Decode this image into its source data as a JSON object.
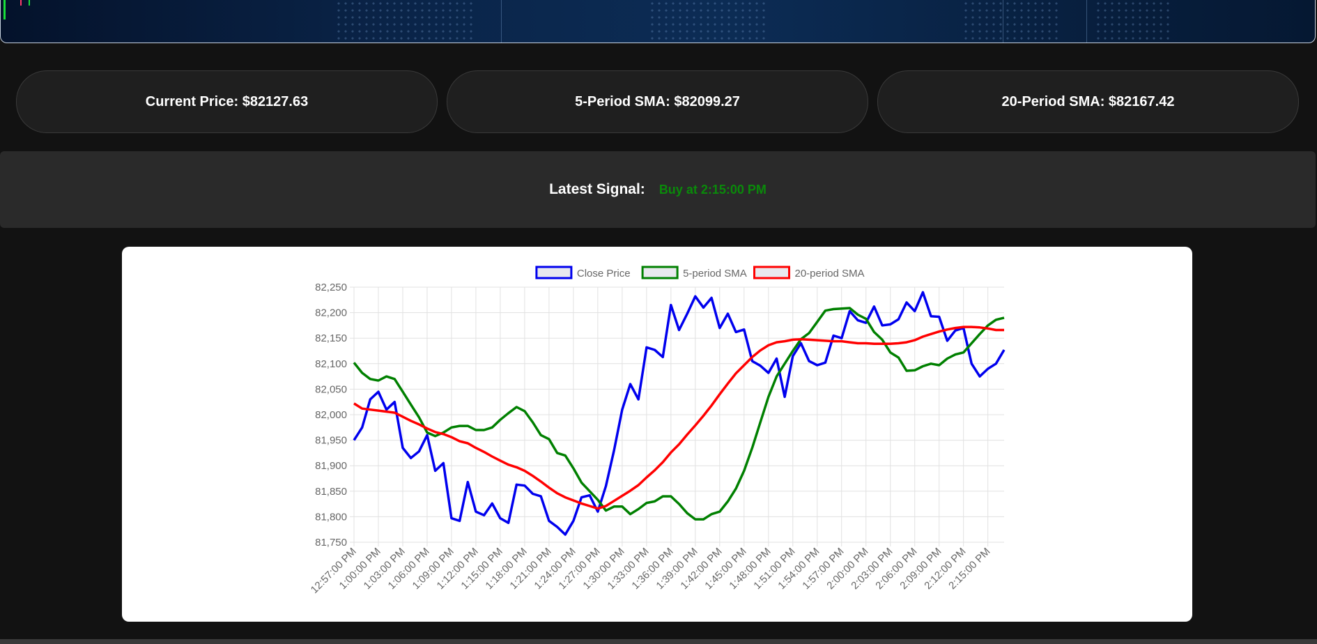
{
  "stats": {
    "current_price": "Current Price: $82127.63",
    "sma5": "5-Period SMA: $82099.27",
    "sma20": "20-Period SMA: $82167.42"
  },
  "signal": {
    "label": "Latest Signal:",
    "value": "Buy at 2:15:00 PM",
    "color": "#0a8a0a"
  },
  "chart_data": {
    "type": "line",
    "x": [
      "12:57:00 PM",
      "12:58:00 PM",
      "12:59:00 PM",
      "1:00:00 PM",
      "1:01:00 PM",
      "1:02:00 PM",
      "1:03:00 PM",
      "1:04:00 PM",
      "1:05:00 PM",
      "1:06:00 PM",
      "1:07:00 PM",
      "1:08:00 PM",
      "1:09:00 PM",
      "1:10:00 PM",
      "1:11:00 PM",
      "1:12:00 PM",
      "1:13:00 PM",
      "1:14:00 PM",
      "1:15:00 PM",
      "1:16:00 PM",
      "1:17:00 PM",
      "1:18:00 PM",
      "1:19:00 PM",
      "1:20:00 PM",
      "1:21:00 PM",
      "1:22:00 PM",
      "1:23:00 PM",
      "1:24:00 PM",
      "1:25:00 PM",
      "1:26:00 PM",
      "1:27:00 PM",
      "1:28:00 PM",
      "1:29:00 PM",
      "1:30:00 PM",
      "1:31:00 PM",
      "1:32:00 PM",
      "1:33:00 PM",
      "1:34:00 PM",
      "1:35:00 PM",
      "1:36:00 PM",
      "1:37:00 PM",
      "1:38:00 PM",
      "1:39:00 PM",
      "1:40:00 PM",
      "1:41:00 PM",
      "1:42:00 PM",
      "1:43:00 PM",
      "1:44:00 PM",
      "1:45:00 PM",
      "1:46:00 PM",
      "1:47:00 PM",
      "1:48:00 PM",
      "1:49:00 PM",
      "1:50:00 PM",
      "1:51:00 PM",
      "1:52:00 PM",
      "1:53:00 PM",
      "1:54:00 PM",
      "1:55:00 PM",
      "1:56:00 PM",
      "1:57:00 PM",
      "1:58:00 PM",
      "1:59:00 PM",
      "2:00:00 PM",
      "2:01:00 PM",
      "2:02:00 PM",
      "2:03:00 PM",
      "2:04:00 PM",
      "2:05:00 PM",
      "2:06:00 PM",
      "2:07:00 PM",
      "2:08:00 PM",
      "2:09:00 PM",
      "2:10:00 PM",
      "2:11:00 PM",
      "2:12:00 PM",
      "2:13:00 PM",
      "2:14:00 PM",
      "2:15:00 PM",
      "2:16:00 PM",
      "2:17:00 PM"
    ],
    "x_tick_labels": [
      "12:57:00 PM",
      "1:00:00 PM",
      "1:03:00 PM",
      "1:06:00 PM",
      "1:09:00 PM",
      "1:12:00 PM",
      "1:15:00 PM",
      "1:18:00 PM",
      "1:21:00 PM",
      "1:24:00 PM",
      "1:27:00 PM",
      "1:30:00 PM",
      "1:33:00 PM",
      "1:36:00 PM",
      "1:39:00 PM",
      "1:42:00 PM",
      "1:45:00 PM",
      "1:48:00 PM",
      "1:51:00 PM",
      "1:54:00 PM",
      "1:57:00 PM",
      "2:00:00 PM",
      "2:03:00 PM",
      "2:06:00 PM",
      "2:09:00 PM",
      "2:12:00 PM",
      "2:15:00 PM"
    ],
    "y_ticks": [
      "82,250",
      "82,200",
      "82,150",
      "82,100",
      "82,050",
      "82,000",
      "81,950",
      "81,900",
      "81,850",
      "81,800",
      "81,750"
    ],
    "ylim": [
      81750,
      82250
    ],
    "grid": true,
    "legend_position": "top",
    "series": [
      {
        "name": "Close Price",
        "color": "#0000ee",
        "values": [
          81950,
          81975,
          82030,
          82045,
          82010,
          82025,
          81935,
          81915,
          81928,
          81960,
          81890,
          81905,
          81797,
          81792,
          81868,
          81810,
          81803,
          81826,
          81797,
          81788,
          81863,
          81861,
          81845,
          81840,
          81792,
          81780,
          81765,
          81792,
          81838,
          81842,
          81810,
          81860,
          81930,
          82010,
          82060,
          82030,
          82132,
          82127,
          82113,
          82215,
          82166,
          82198,
          82232,
          82210,
          82229,
          82170,
          82198,
          82162,
          82167,
          82105,
          82096,
          82082,
          82110,
          82035,
          82115,
          82140,
          82105,
          82097,
          82102,
          82155,
          82150,
          82203,
          82185,
          82180,
          82212,
          82175,
          82177,
          82187,
          82220,
          82203,
          82240,
          82193,
          82192,
          82145,
          82165,
          82170,
          82100,
          82075,
          82090,
          82100,
          82127
        ]
      },
      {
        "name": "5-period SMA",
        "color": "#008000",
        "values": [
          82102,
          82082,
          82070,
          82067,
          82075,
          82070,
          82045,
          82020,
          81995,
          81965,
          81958,
          81965,
          81975,
          81978,
          81978,
          81970,
          81970,
          81975,
          81990,
          82003,
          82015,
          82007,
          81985,
          81960,
          81952,
          81925,
          81920,
          81895,
          81867,
          81850,
          81833,
          81812,
          81820,
          81820,
          81805,
          81815,
          81827,
          81830,
          81840,
          81840,
          81825,
          81807,
          81795,
          81795,
          81805,
          81810,
          81830,
          81855,
          81890,
          81935,
          81985,
          82035,
          82075,
          82100,
          82125,
          82148,
          82160,
          82182,
          82204,
          82207,
          82208,
          82209,
          82196,
          82188,
          82162,
          82147,
          82122,
          82112,
          82086,
          82087,
          82095,
          82100,
          82097,
          82110,
          82118,
          82122,
          82140,
          82158,
          82175,
          82186,
          82190
        ]
      },
      {
        "name": "20-period SMA",
        "color": "#ff0000",
        "values": [
          82022,
          82012,
          82010,
          82008,
          82006,
          82004,
          81996,
          81988,
          81981,
          81973,
          81966,
          81962,
          81956,
          81948,
          81944,
          81935,
          81927,
          81918,
          81910,
          81902,
          81897,
          81890,
          81880,
          81869,
          81857,
          81846,
          81838,
          81832,
          81826,
          81821,
          81816,
          81821,
          81831,
          81841,
          81851,
          81862,
          81877,
          81891,
          81907,
          81926,
          81942,
          81961,
          81979,
          81998,
          82018,
          82040,
          82061,
          82081,
          82097,
          82113,
          82126,
          82136,
          82142,
          82144,
          82147,
          82148,
          82147,
          82146,
          82145,
          82144,
          82144,
          82142,
          82140,
          82140,
          82139,
          82139,
          82139,
          82140,
          82142,
          82146,
          82153,
          82158,
          82163,
          82167,
          82170,
          82172,
          82172,
          82171,
          82169,
          82166,
          82166
        ]
      }
    ]
  }
}
